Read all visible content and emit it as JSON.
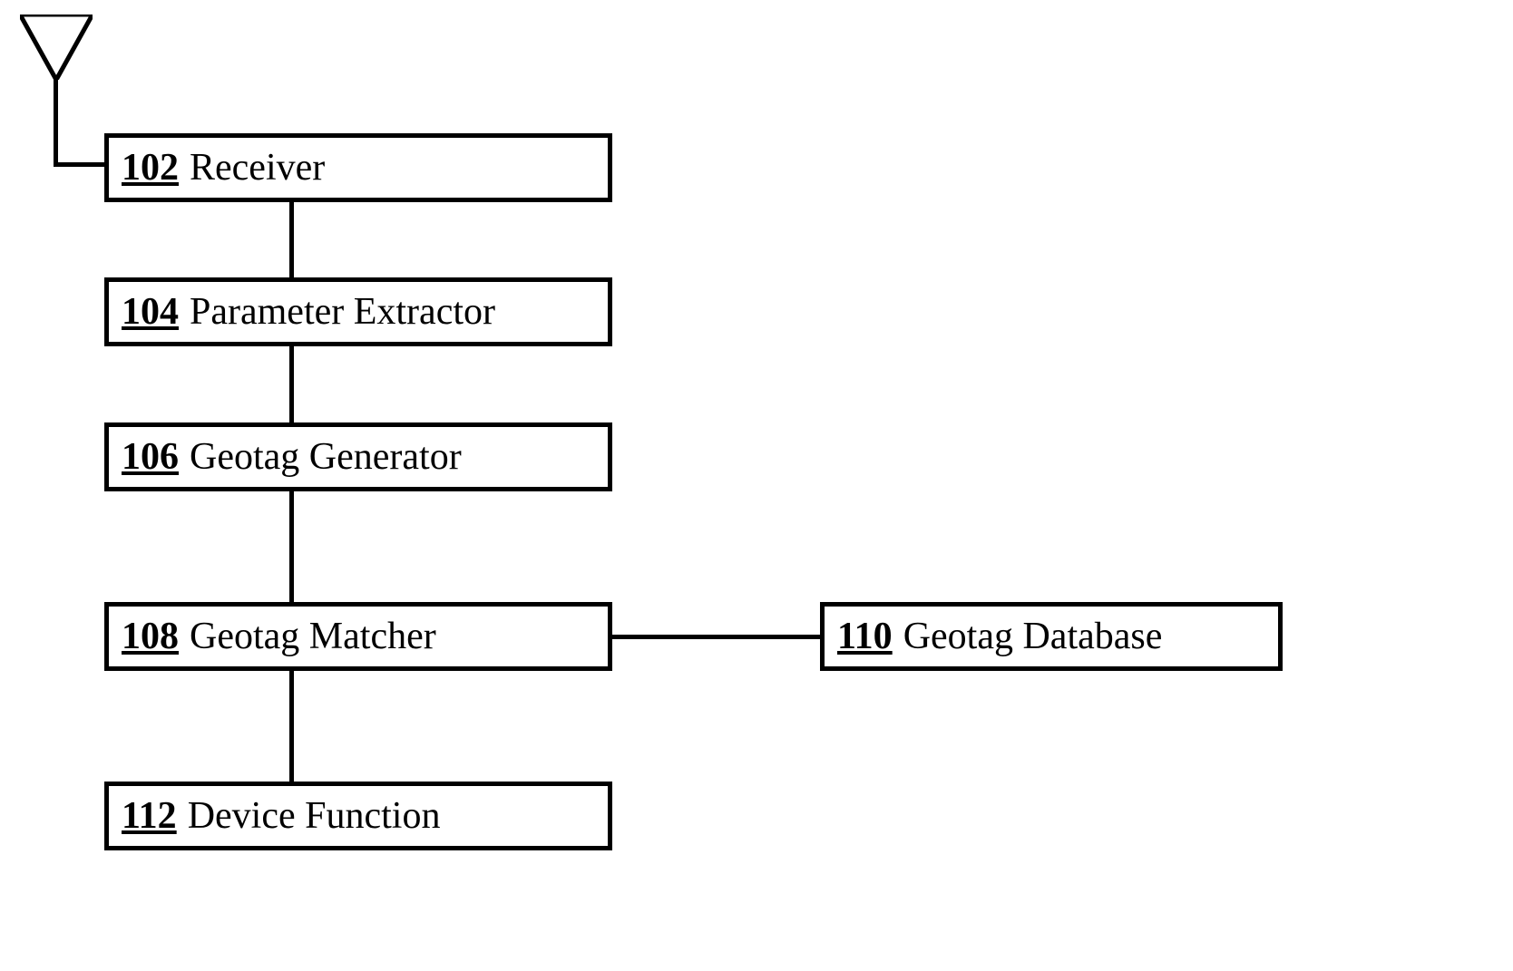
{
  "blocks": {
    "receiver": {
      "num": "102",
      "label": "Receiver"
    },
    "extractor": {
      "num": "104",
      "label": "Parameter Extractor"
    },
    "generator": {
      "num": "106",
      "label": "Geotag Generator"
    },
    "matcher": {
      "num": "108",
      "label": "Geotag Matcher"
    },
    "database": {
      "num": "110",
      "label": "Geotag Database"
    },
    "device_function": {
      "num": "112",
      "label": "Device Function"
    }
  }
}
